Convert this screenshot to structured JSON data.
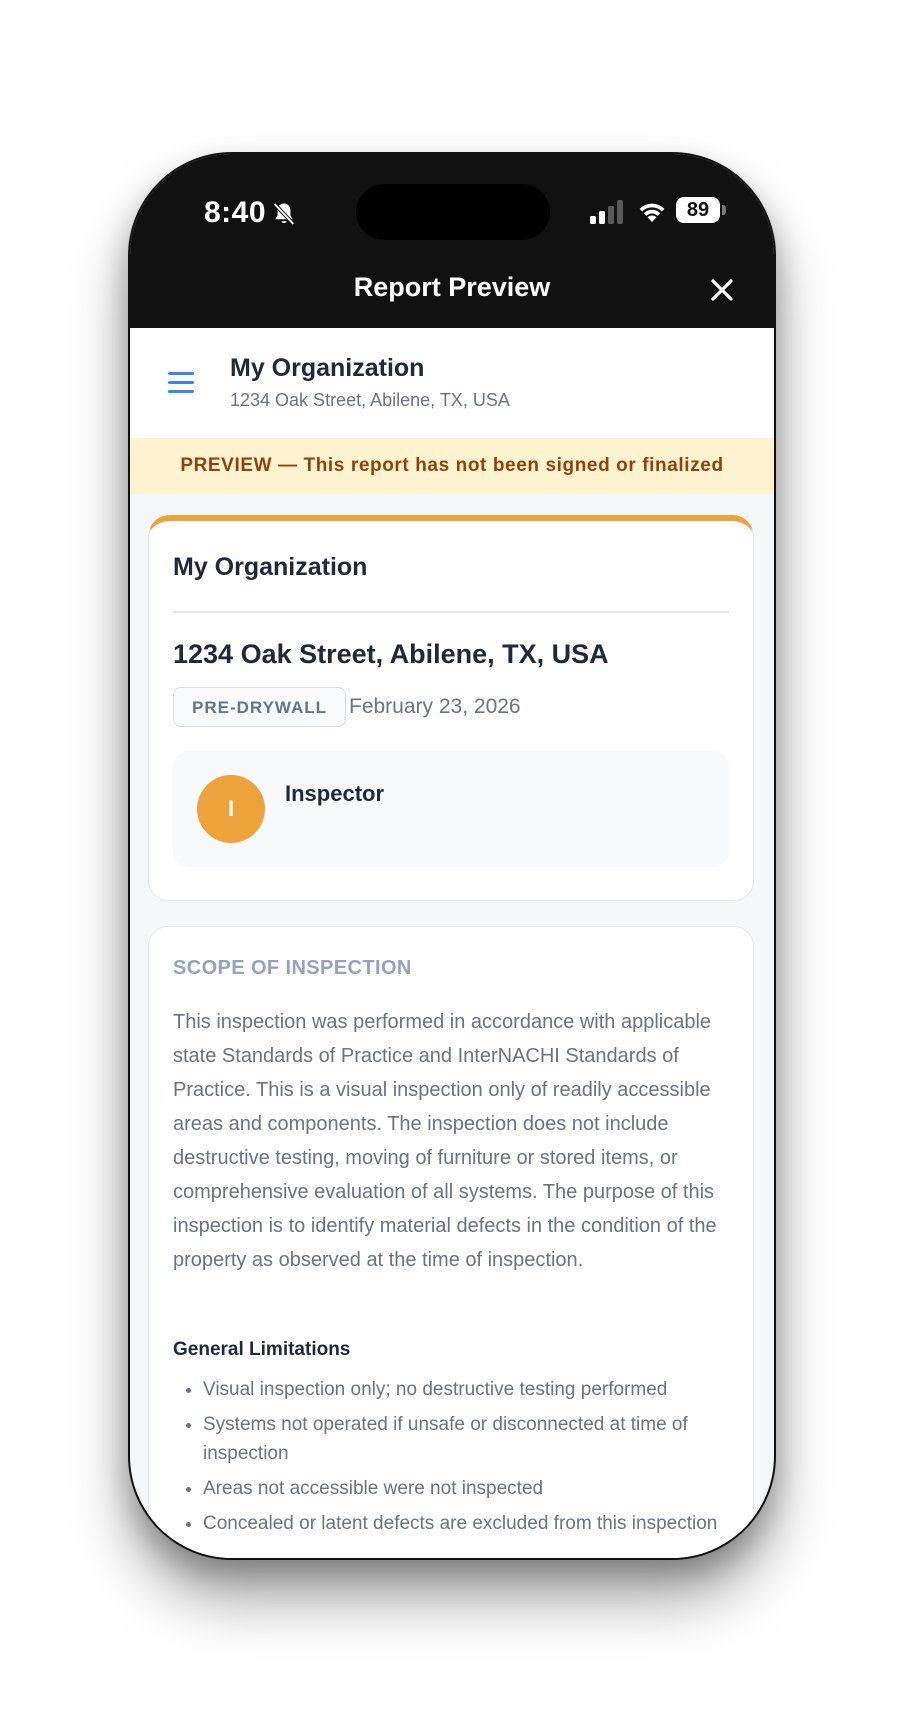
{
  "status_bar": {
    "time": "8:40",
    "battery": "89"
  },
  "nav": {
    "title": "Report Preview"
  },
  "header": {
    "org_name": "My Organization",
    "address": "1234 Oak Street, Abilene, TX, USA"
  },
  "banner": {
    "text": "PREVIEW — This report has not been signed or finalized"
  },
  "report_card": {
    "org_name": "My Organization",
    "address": "1234 Oak Street, Abilene, TX, USA",
    "inspection_type": "PRE-DRYWALL",
    "date": "February 23, 2026",
    "inspector_initial": "I",
    "inspector_label": "Inspector"
  },
  "scope": {
    "title": "SCOPE OF INSPECTION",
    "body": "This inspection was performed in accordance with applicable state Standards of Practice and InterNACHI Standards of Practice. This is a visual inspection only of readily accessible areas and components. The inspection does not include destructive testing, moving of furniture or stored items, or comprehensive evaluation of all systems. The purpose of this inspection is to identify material defects in the condition of the property as observed at the time of inspection.",
    "limitations_title": "General Limitations",
    "limitations": [
      "Visual inspection only; no destructive testing performed",
      "Systems not operated if unsafe or disconnected at time of inspection",
      "Areas not accessible were not inspected",
      "Concealed or latent defects are excluded from this inspection"
    ]
  },
  "colors": {
    "accent": "#eea23c",
    "menu": "#3b82f6",
    "banner_bg": "#fdf3cf",
    "banner_text": "#92400e"
  },
  "icons": [
    "bell-slash-icon",
    "signal-icon",
    "wifi-icon",
    "battery-icon",
    "close-icon",
    "hamburger-menu-icon"
  ]
}
